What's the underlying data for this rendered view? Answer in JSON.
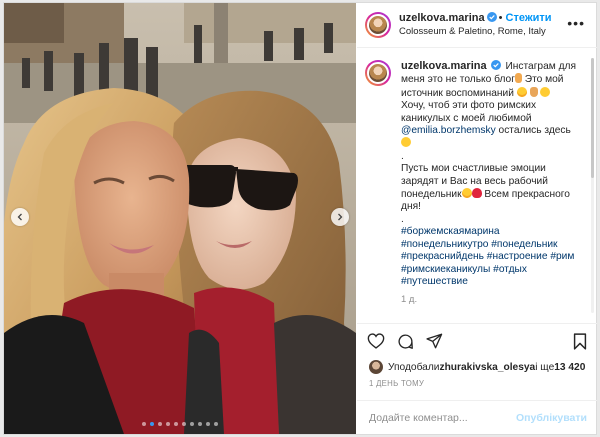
{
  "post": {
    "photo": {
      "nav_prev_icon": "chevron-left-icon",
      "nav_next_icon": "chevron-right-icon",
      "carousel_total": 10,
      "carousel_active": 2
    },
    "header": {
      "username": "uzelkova.marina",
      "verified_icon": "verified-badge-icon",
      "separator": "•",
      "follow_label": "Стежити",
      "location": "Colosseum & Paletino, Rome, Italy",
      "more_icon": "more-options-icon"
    },
    "caption": {
      "username": "uzelkova.marina",
      "part1": "Инстаграм для меня это не только блог",
      "part2": " Это мой источник воспоминаний",
      "part3": "Хочу, чтоб эти фото римских каникулых с моей любимой ",
      "mention": "@emilia.borzhemsky",
      "part4": " остались здесь",
      "dot": ".",
      "part5": "Пусть мои счастливые эмоции зарядят и Вас на весь рабочий понедельник",
      "part6": " Всем прекрасного дня!",
      "dot2": ".",
      "hashtags": [
        "#боржемскаямарина",
        "#понедельникутро",
        "#понедельник",
        "#прекраснийдень",
        "#настроение",
        "#рим",
        "#римскиеканикулы",
        "#отдых",
        "#путешествие"
      ],
      "time": "1 д."
    },
    "actions": {
      "like_icon": "heart-icon",
      "comment_icon": "comment-icon",
      "share_icon": "share-icon",
      "save_icon": "bookmark-icon"
    },
    "likes": {
      "prefix": "Уподобали ",
      "user": "zhurakivska_olesya",
      "middle": " і ще ",
      "count": "13 420"
    },
    "posted_ago": "1 ДЕНЬ ТОМУ",
    "comment": {
      "placeholder": "Додайте коментар...",
      "publish_label": "Опублікувати"
    },
    "colors": {
      "link_blue": "#0095f6",
      "publish_disabled": "#b2dffc",
      "hashtag": "#00376b",
      "muted": "#8e8e8e"
    }
  }
}
